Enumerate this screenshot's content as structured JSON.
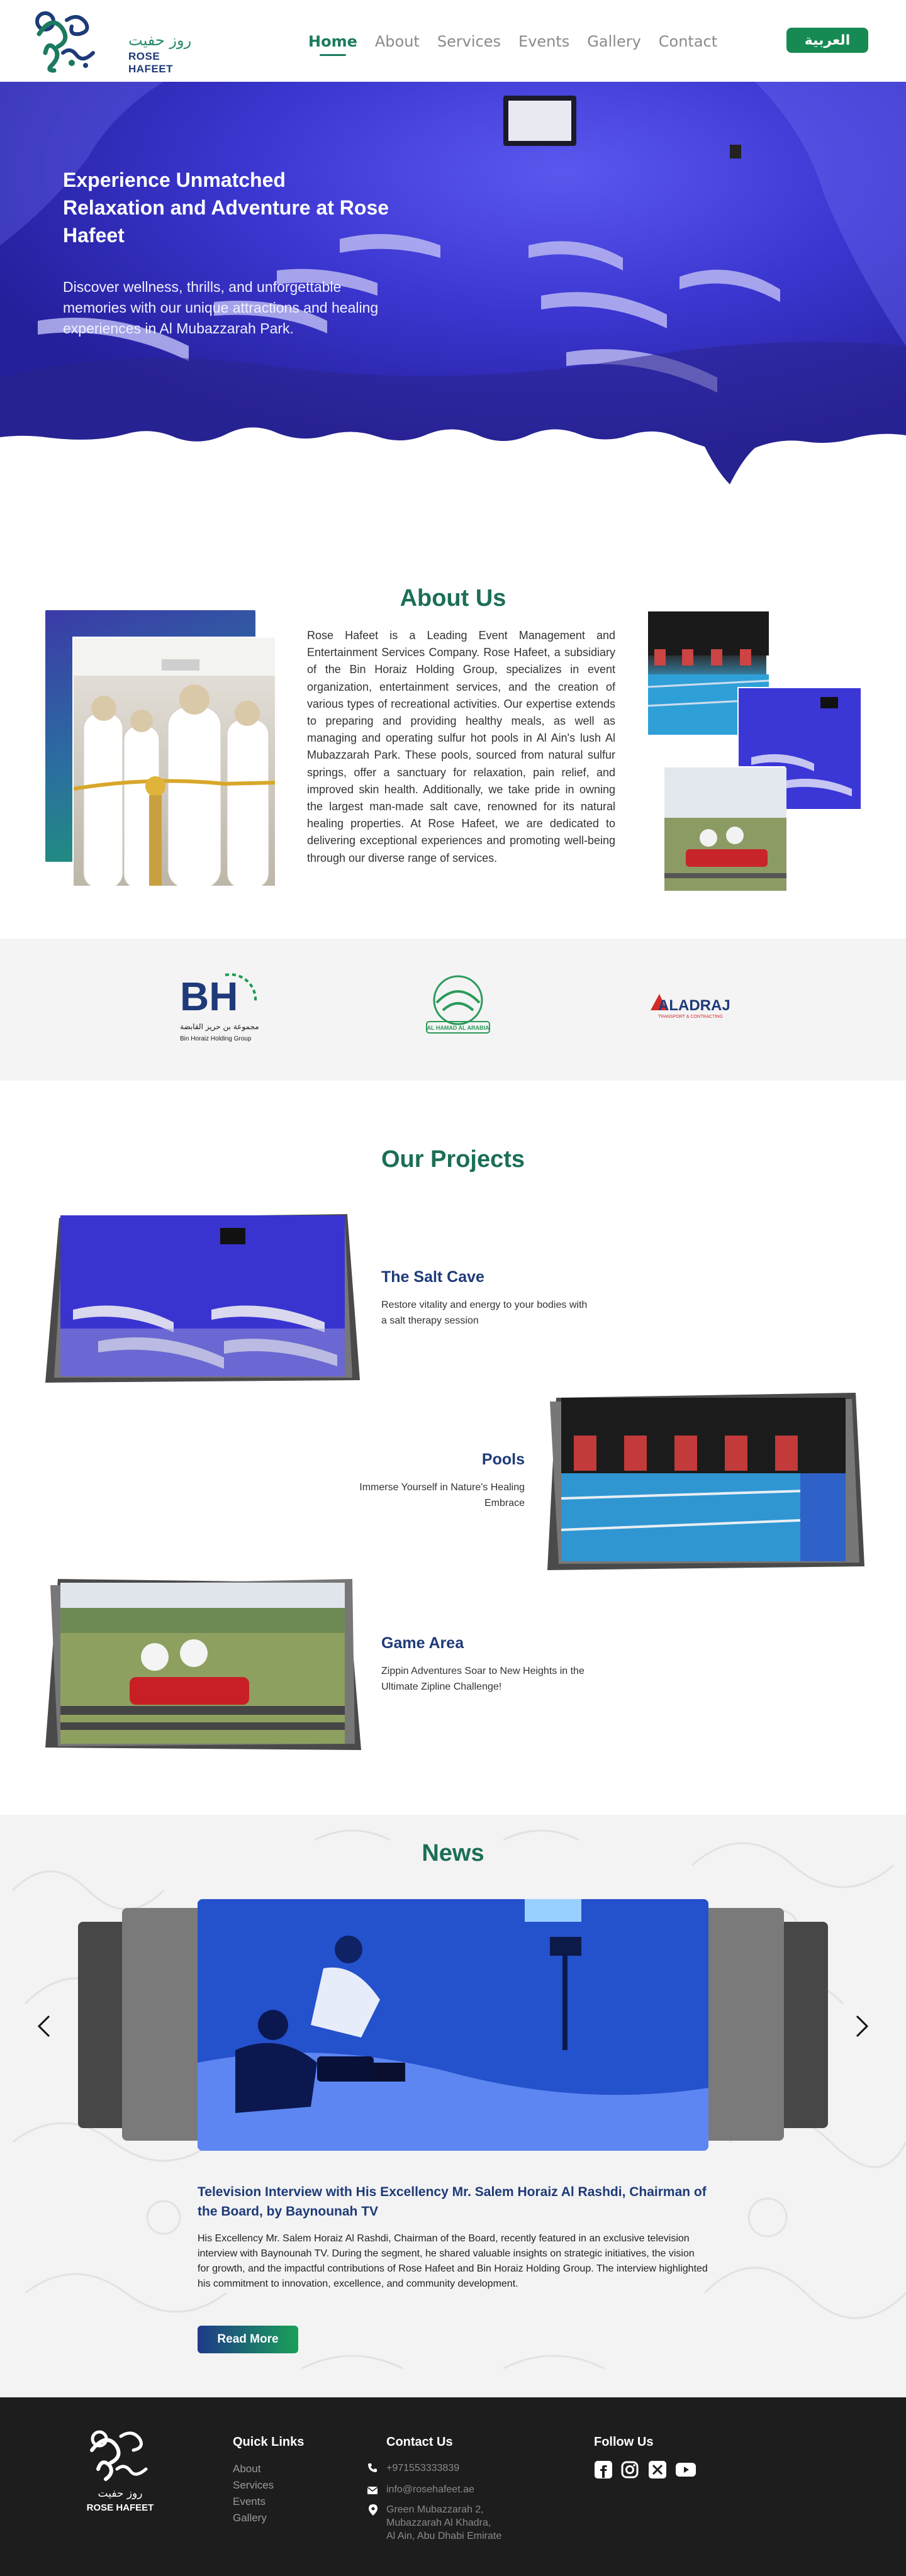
{
  "brand": {
    "name_en": "ROSE HAFEET",
    "name_ar": "روز حفيت",
    "primary_green": "#178a53",
    "navy": "#1e3a78"
  },
  "nav": {
    "links": [
      {
        "label": "Home",
        "active": true
      },
      {
        "label": "About",
        "active": false
      },
      {
        "label": "Services",
        "active": false
      },
      {
        "label": "Events",
        "active": false
      },
      {
        "label": "Gallery",
        "active": false
      },
      {
        "label": "Contact",
        "active": false
      }
    ],
    "language_button": "العربية"
  },
  "hero": {
    "title": "Experience Unmatched Relaxation and Adventure at Rose Hafeet",
    "subtitle": "Discover wellness, thrills, and unforgettable memories with our unique attractions and healing experiences in Al Mubazzarah Park."
  },
  "about": {
    "title": "About Us",
    "body": "Rose Hafeet is a Leading Event Management and Entertainment Services Company. Rose Hafeet, a subsidiary of the Bin Horaiz Holding Group, specializes in event organization, entertainment services, and the creation of various types of recreational activities. Our expertise extends to preparing and providing healthy meals, as well as managing and operating sulfur hot pools in Al Ain's lush Al Mubazzarah Park. These pools, sourced from natural sulfur springs, offer a sanctuary for relaxation, pain relief, and improved skin health. Additionally, we take pride in owning the largest man-made salt cave, renowned for its natural healing properties. At Rose Hafeet, we are dedicated to delivering exceptional experiences and promoting well-being through our diverse range of services."
  },
  "partners": [
    {
      "name": "BH",
      "caption_ar": "مجموعة بن حريز القابضة",
      "caption_en": "Bin Horaiz Holding Group"
    },
    {
      "name": "AL HAMAD AL ARABIA"
    },
    {
      "name": "ALADRAJ",
      "caption": "TRANSPORT & CONTRACTING"
    }
  ],
  "projects": {
    "title": "Our Projects",
    "items": [
      {
        "name": "The Salt Cave",
        "description": "Restore vitality and energy to your bodies with a salt therapy session"
      },
      {
        "name": "Pools",
        "description": "Immerse Yourself in Nature's Healing Embrace"
      },
      {
        "name": "Game Area",
        "description": "Zippin Adventures Soar to New Heights in the Ultimate Zipline Challenge!"
      }
    ]
  },
  "news": {
    "title": "News",
    "headline": "Television Interview with His Excellency Mr. Salem Horaiz Al Rashdi, Chairman of the Board, by Baynounah TV",
    "body": "His Excellency Mr. Salem Horaiz Al Rashdi, Chairman of the Board, recently featured in an exclusive television interview with Baynounah TV. During the segment, he shared valuable insights on strategic initiatives, the vision for growth, and the impactful contributions of Rose Hafeet and Bin Horaiz Holding Group. The interview highlighted his commitment to innovation, excellence, and community development.",
    "read_more": "Read More"
  },
  "footer": {
    "brand_en": "ROSE HAFEET",
    "brand_ar": "روز حفيت",
    "quick_links_title": "Quick Links",
    "quick_links": [
      "About",
      "Services",
      "Events",
      "Gallery"
    ],
    "contact_title": "Contact Us",
    "phone": "+971553333839",
    "email": "info@rosehafeet.ae",
    "address_lines": [
      "Green Mubazzarah 2,",
      "Mubazzarah Al Khadra,",
      "Al Ain, Abu Dhabi Emirate"
    ],
    "follow_title": "Follow Us",
    "social": [
      "facebook-icon",
      "instagram-icon",
      "x-icon",
      "youtube-icon"
    ]
  }
}
